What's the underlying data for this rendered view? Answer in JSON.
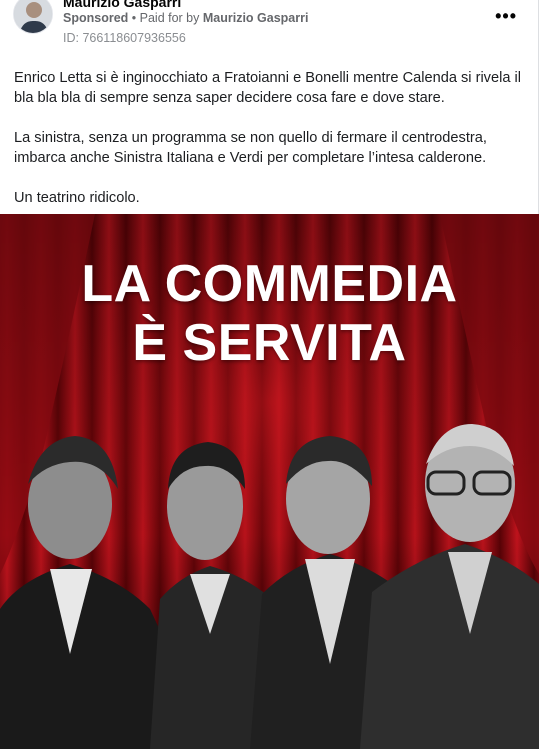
{
  "post": {
    "author": "Maurizio Gasparri",
    "sponsored_label": "Sponsored",
    "separator": " • ",
    "paid_for_prefix": "Paid for by",
    "paid_for_name": "Maurizio Gasparri",
    "ad_id": "ID: 766118607936556",
    "more_label": "•••",
    "paragraphs": [
      "Enrico Letta si è inginocchiato a Fratoianni e Bonelli mentre Calenda si rivela il bla bla bla di sempre senza saper decidere cosa fare e dove stare.",
      "La sinistra, senza un programma se non quello di fermare il centrodestra, imbarca anche Sinistra Italiana e Verdi per completare l’intesa calderone.",
      "Un teatrino ridicolo."
    ]
  },
  "banner": {
    "headline_line1": "LA COMMEDIA",
    "headline_line2": "È SERVITA",
    "curtain_color": "#b0121a",
    "curtain_dark": "#5a0206"
  }
}
